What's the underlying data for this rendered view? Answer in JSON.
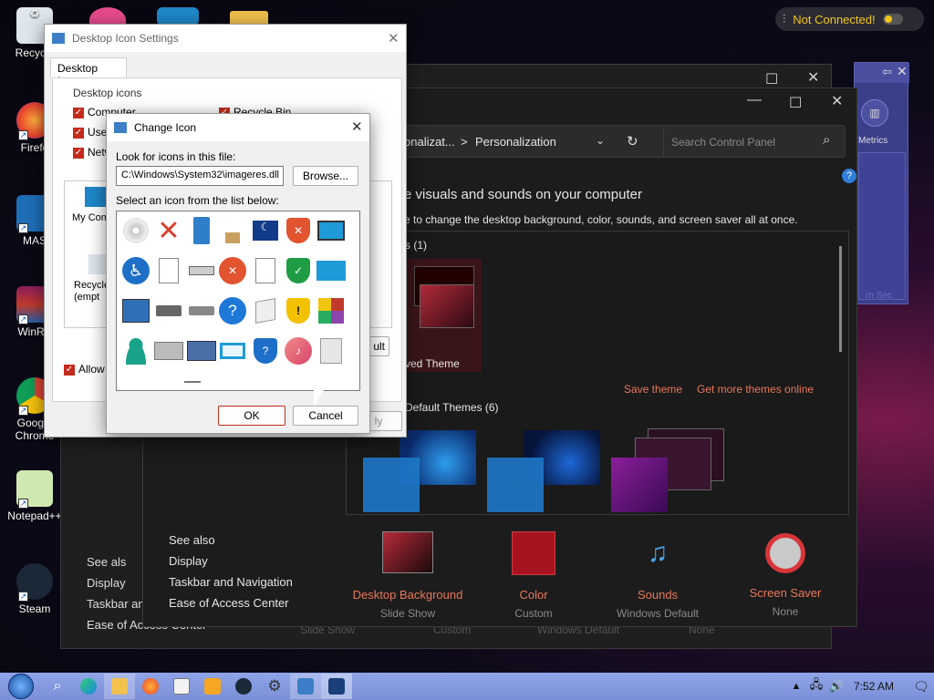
{
  "desktop": {
    "icons": [
      {
        "label": "Recycle",
        "name": "recycle-bin-desktop-icon"
      },
      {
        "label": "Firefo",
        "name": "firefox-desktop-icon"
      },
      {
        "label": "MAS",
        "name": "mas-desktop-icon"
      },
      {
        "label": "WinRA",
        "name": "winrar-desktop-icon"
      },
      {
        "label": "Google Chrome",
        "name": "chrome-desktop-icon"
      },
      {
        "label": "Notepad++",
        "name": "notepadpp-desktop-icon"
      },
      {
        "label": "Steam",
        "name": "steam-desktop-icon"
      }
    ]
  },
  "vpn": {
    "status": "Not Connected!"
  },
  "metrics": {
    "label": "Metrics",
    "faded": "rn Sec"
  },
  "back_panel": {
    "see_also": "See als",
    "links": [
      "Display",
      "Taskbar and",
      "Ease of Access Center"
    ],
    "faded_captions": [
      "Slide Show",
      "Custom",
      "Windows Default",
      "None"
    ]
  },
  "personalization": {
    "breadcrumb_prev": "onalizat...",
    "breadcrumb_sep": ">",
    "breadcrumb_current": "Personalization",
    "search_placeholder": "Search Control Panel",
    "heading": "e visuals and sounds on your computer",
    "subheading": "e to change the desktop background, color, sounds, and screen saver all at once.",
    "my_themes": "s (1)",
    "saved_theme": "ved Theme",
    "save_theme": "Save theme",
    "more_themes": "Get more themes online",
    "default_themes": "Default Themes (6)",
    "see_also": "See also",
    "links": [
      "Display",
      "Taskbar and Navigation",
      "Ease of Access Center"
    ],
    "bottom": [
      {
        "title": "Desktop Background",
        "sub": "Slide Show"
      },
      {
        "title": "Color",
        "sub": "Custom"
      },
      {
        "title": "Sounds",
        "sub": "Windows Default"
      },
      {
        "title": "Screen Saver",
        "sub": "None"
      }
    ],
    "help": "?"
  },
  "desktop_icon_settings": {
    "title": "Desktop Icon Settings",
    "tab": "Desktop Icons",
    "group": "Desktop icons",
    "checks": [
      "Computer",
      "User",
      "Netw",
      "Recycle Bin"
    ],
    "items": [
      "My Comp",
      "Recycle (empt"
    ],
    "allow": "Allow t",
    "btn_fragment": "ult",
    "apply_fragment": "ly"
  },
  "change_icon": {
    "title": "Change Icon",
    "look_label": "Look for icons in this file:",
    "path": "C:\\Windows\\System32\\imageres.dll",
    "browse": "Browse...",
    "select_label": "Select an icon from the list below:",
    "ok": "OK",
    "cancel": "Cancel"
  },
  "taskbar": {
    "time": "7:52 AM"
  }
}
